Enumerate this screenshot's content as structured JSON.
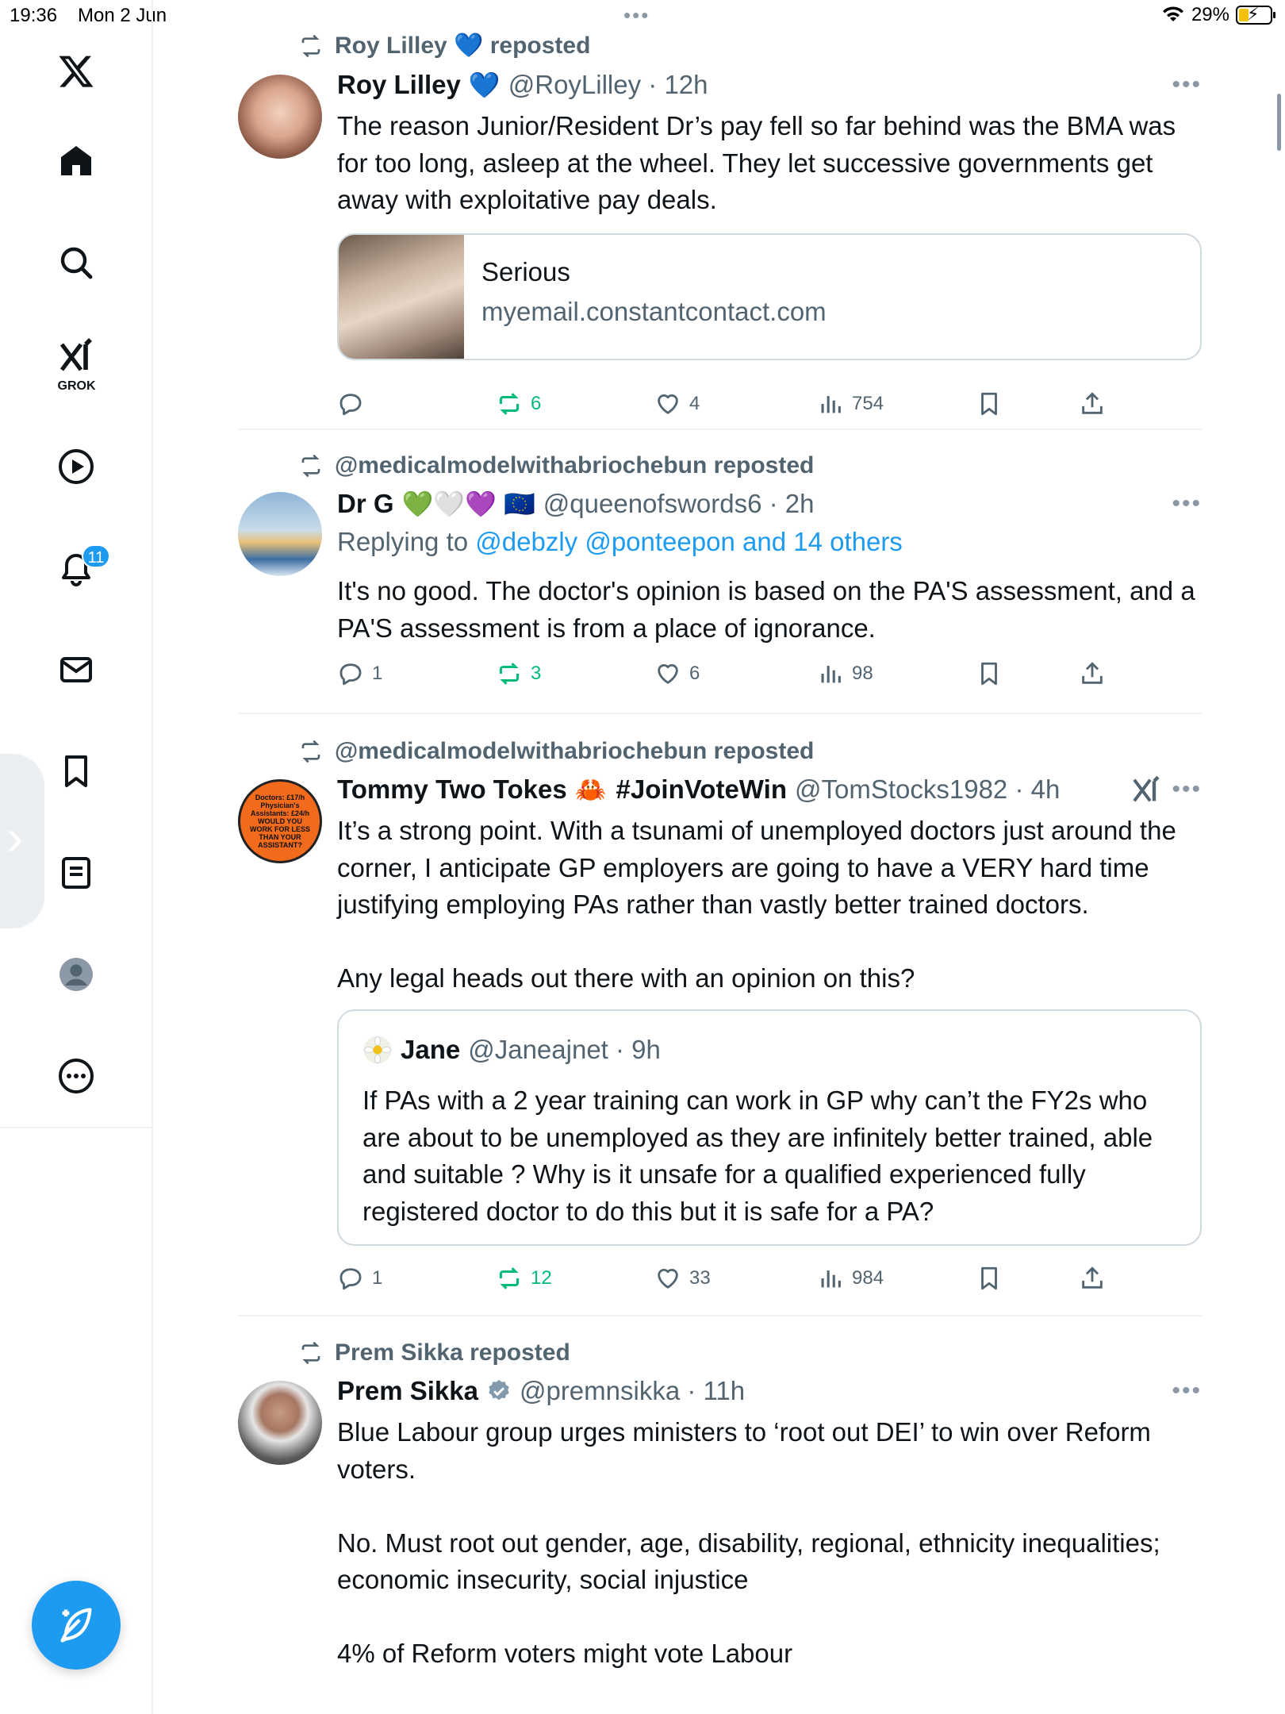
{
  "status_bar": {
    "time": "19:36",
    "date": "Mon 2 Jun",
    "battery": "29%"
  },
  "sidebar": {
    "items": [
      {
        "name": "x-logo"
      },
      {
        "name": "home"
      },
      {
        "name": "explore"
      },
      {
        "name": "grok",
        "label": "GROK"
      },
      {
        "name": "videos"
      },
      {
        "name": "notifications",
        "badge": "11"
      },
      {
        "name": "messages"
      },
      {
        "name": "bookmarks"
      },
      {
        "name": "lists"
      },
      {
        "name": "profile"
      },
      {
        "name": "more"
      }
    ]
  },
  "tweets": [
    {
      "repost_by": "Roy Lilley 💙 reposted",
      "name": "Roy Lilley",
      "emoji": "💙",
      "handle": "@RoyLilley · 12h",
      "text": "The reason Junior/Resident Dr’s pay fell so far behind was the BMA was for too long, asleep at the wheel. They let successive governments get away with exploitative pay deals.",
      "card": {
        "title": "Serious",
        "domain": "myemail.constantcontact.com"
      },
      "stats": {
        "replies": "",
        "reposts": "6",
        "likes": "4",
        "views": "754"
      }
    },
    {
      "repost_by": "@medicalmodelwithabriochebun reposted",
      "name": "Dr G",
      "emoji": "💚🤍💜 🇪🇺",
      "handle": "@queenofswords6 · 2h",
      "reply_prefix": "Replying to ",
      "reply_targets": "@debzly @ponteepon and 14 others",
      "text": "It's no good. The doctor's opinion is based on the PA'S assessment, and a PA'S assessment is from a place of ignorance.",
      "stats": {
        "replies": "1",
        "reposts": "3",
        "likes": "6",
        "views": "98"
      }
    },
    {
      "repost_by": "@medicalmodelwithabriochebun reposted",
      "name": "Tommy Two Tokes",
      "emoji": "🦀",
      "hashtag": "#JoinVoteWin",
      "handle": "@TomStocks1982 · 4h",
      "avatar_text": "Doctors: £17/h Physician's Assistants: £24/h WOULD YOU WORK FOR LESS THAN YOUR ASSISTANT?",
      "text": "It’s a strong point. With a tsunami of unemployed doctors just around the corner, I anticipate GP employers are going to have a VERY hard time justifying employing PAs rather than vastly better trained doctors.\n\nAny legal heads out there with an opinion on this?",
      "quote": {
        "name": "Jane",
        "handle": "@Janeajnet · 9h",
        "text": "If PAs with a 2 year training can work in GP why can’t the FY2s who are about to be unemployed as they are infinitely better trained, able and suitable ? Why is it unsafe for a qualified experienced fully registered doctor to do this but it is safe for a PA?"
      },
      "stats": {
        "replies": "1",
        "reposts": "12",
        "likes": "33",
        "views": "984"
      }
    },
    {
      "repost_by": "Prem Sikka reposted",
      "name": "Prem Sikka",
      "handle": "@premnsikka · 11h",
      "text": "Blue Labour group urges ministers to ‘root out DEI’ to win over Reform voters.\n\nNo. Must root out gender, age, disability, regional, ethnicity inequalities; economic insecurity, social injustice\n\n4% of Reform voters might vote Labour"
    }
  ],
  "colors": {
    "accent": "#1d9bf0",
    "repost_green": "#00ba7c",
    "secondary_text": "#536471"
  }
}
